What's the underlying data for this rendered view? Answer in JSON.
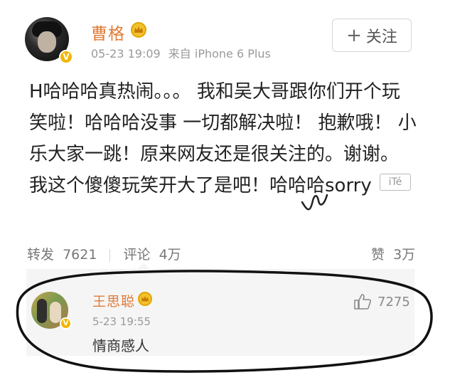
{
  "post": {
    "author": "曹格",
    "date": "05-23 19:09",
    "source": "来自 iPhone 6 Plus",
    "follow_label": "关注",
    "text": "H哈哈哈真热闹。。。 我和吴大哥跟你们开个玩笑啦！哈哈哈没事 一切都解决啦！ 抱歉哦！ 小乐大家一跳！原来网友还是很关注的。谢谢。我这个傻傻玩笑开大了是吧！哈哈哈sorry",
    "watermark": "iTé"
  },
  "actions": {
    "repost_label": "转发",
    "repost_count": "7621",
    "comment_label": "评论",
    "comment_count": "4万",
    "like_label": "赞",
    "like_count": "3万"
  },
  "comment": {
    "author": "王思聪",
    "date": "5-23 19:55",
    "text": "情商感人",
    "like_count": "7275"
  },
  "colors": {
    "name_orange": "#e07a36",
    "meta_gray": "#9a9a9a",
    "badge_yellow": "#f2b500",
    "comment_bg": "#f5f5f5"
  },
  "icons": {
    "verified": "verified-badge-icon",
    "vip": "crown-icon",
    "thumb": "thumbs-up-icon",
    "plus": "plus-icon"
  }
}
